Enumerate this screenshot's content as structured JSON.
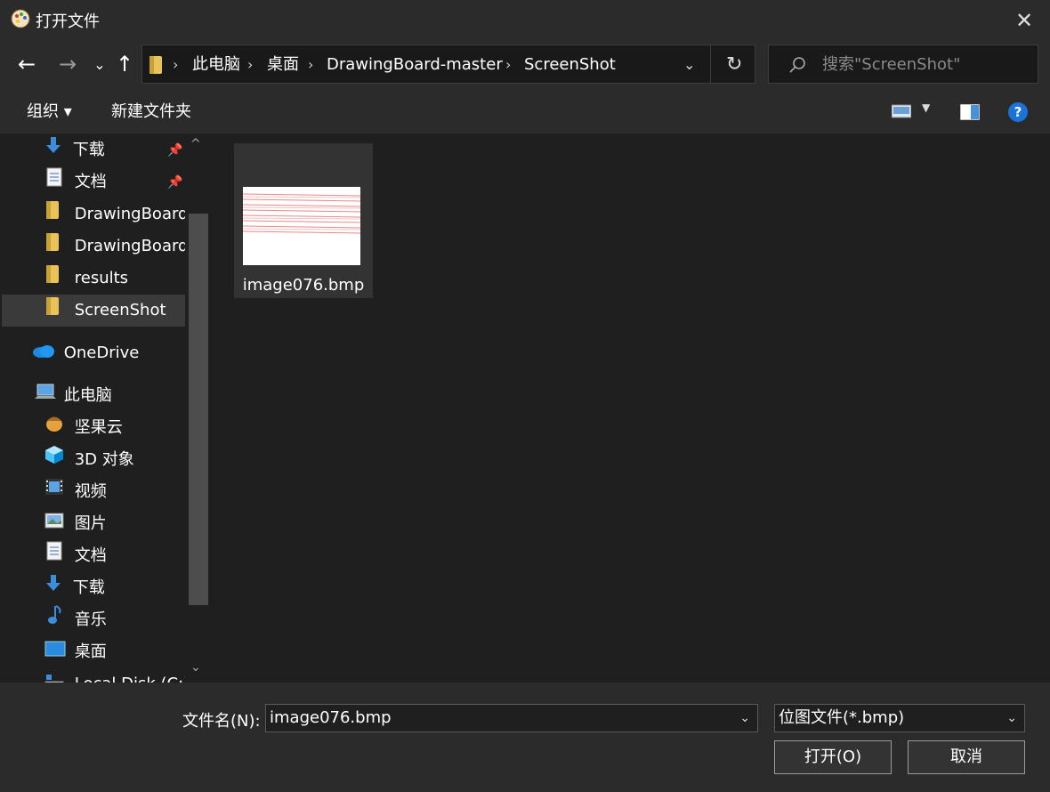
{
  "window": {
    "title": "打开文件"
  },
  "address": {
    "crumbs": [
      "此电脑",
      "桌面",
      "DrawingBoard-master",
      "ScreenShot"
    ],
    "separator": "›"
  },
  "search": {
    "placeholder": "搜索\"ScreenShot\""
  },
  "toolbar": {
    "organize_label": "组织 ▾",
    "new_folder_label": "新建文件夹",
    "help_label": "?"
  },
  "sidebar": {
    "quick_access": [
      {
        "label": "下载",
        "icon": "download-arrow-icon",
        "pinned": true
      },
      {
        "label": "文档",
        "icon": "document-icon",
        "pinned": true
      },
      {
        "label": "DrawingBoard",
        "icon": "folder-icon"
      },
      {
        "label": "DrawingBoard-",
        "icon": "folder-icon"
      },
      {
        "label": "results",
        "icon": "folder-icon"
      },
      {
        "label": "ScreenShot",
        "icon": "folder-icon",
        "selected": true
      }
    ],
    "onedrive_label": "OneDrive",
    "this_pc_label": "此电脑",
    "pc_items": [
      {
        "label": "坚果云",
        "icon": "nut-cloud-icon"
      },
      {
        "label": "3D 对象",
        "icon": "3d-objects-icon"
      },
      {
        "label": "视频",
        "icon": "video-icon"
      },
      {
        "label": "图片",
        "icon": "pictures-icon"
      },
      {
        "label": "文档",
        "icon": "document-icon"
      },
      {
        "label": "下载",
        "icon": "download-arrow-icon"
      },
      {
        "label": "音乐",
        "icon": "music-icon"
      },
      {
        "label": "桌面",
        "icon": "desktop-icon"
      },
      {
        "label": "Local Disk (C:)",
        "icon": "drive-icon"
      }
    ]
  },
  "files": [
    {
      "name": "image076.bmp"
    }
  ],
  "bottom": {
    "filename_label": "文件名(N):",
    "filename_value": "image076.bmp",
    "filetype_value": "位图文件(*.bmp)",
    "open_label": "打开(O)",
    "cancel_label": "取消"
  },
  "colors": {
    "accent": "#0078d7",
    "folder": "#e8c35a",
    "selected": "#3a3a3a"
  }
}
